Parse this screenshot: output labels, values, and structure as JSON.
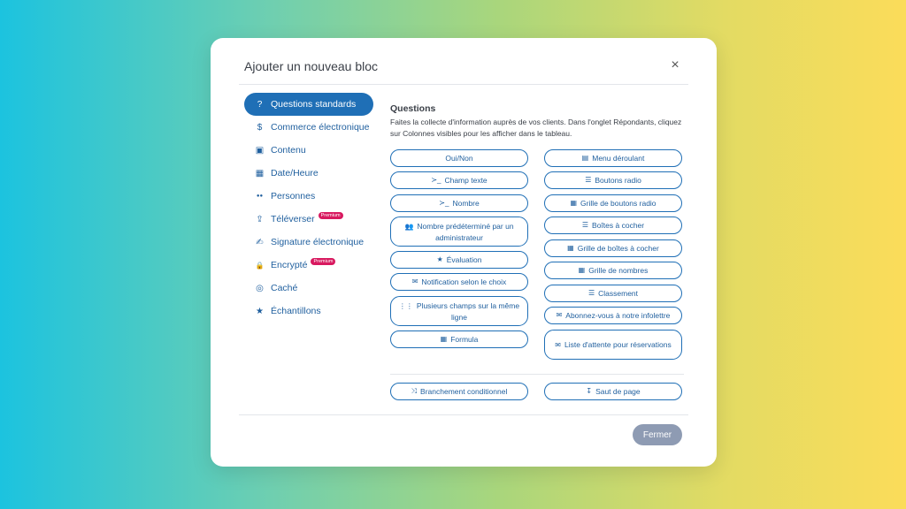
{
  "modal": {
    "title": "Ajouter un nouveau bloc",
    "close_symbol": "×",
    "footer_close": "Fermer"
  },
  "sidebar": {
    "items": [
      {
        "label": "Questions standards",
        "icon": "question-icon",
        "glyph": "?"
      },
      {
        "label": "Commerce électronique",
        "icon": "dollar-icon",
        "glyph": "$"
      },
      {
        "label": "Contenu",
        "icon": "image-icon",
        "glyph": "▣"
      },
      {
        "label": "Date/Heure",
        "icon": "calendar-icon",
        "glyph": "▦"
      },
      {
        "label": "Personnes",
        "icon": "users-icon",
        "glyph": "●●"
      },
      {
        "label": "Téléverser",
        "icon": "upload-icon",
        "glyph": "⇪",
        "badge": "Premium"
      },
      {
        "label": "Signature électronique",
        "icon": "signature-icon",
        "glyph": "✍"
      },
      {
        "label": "Encrypté",
        "icon": "lock-icon",
        "glyph": "🔒",
        "badge": "Premium"
      },
      {
        "label": "Caché",
        "icon": "eye-slash-icon",
        "glyph": "◎"
      },
      {
        "label": "Échantillons",
        "icon": "star-icon",
        "glyph": "★"
      }
    ]
  },
  "questions": {
    "title": "Questions",
    "description": "Faites la collecte d'information auprès de vos clients. Dans l'onglet Répondants, cliquez sur Colonnes visibles pour les afficher dans le tableau.",
    "left": [
      {
        "label": "Oui/Non",
        "glyph": ""
      },
      {
        "label": "Champ texte",
        "glyph": "≻_"
      },
      {
        "label": "Nombre",
        "glyph": "≻_"
      },
      {
        "label": "Nombre prédéterminé par un administrateur",
        "glyph": "👥"
      },
      {
        "label": "Évaluation",
        "glyph": "★"
      },
      {
        "label": "Notification selon le choix",
        "glyph": "✉"
      },
      {
        "label": "Plusieurs champs sur la même ligne",
        "glyph": "⋮⋮"
      },
      {
        "label": "Formula",
        "glyph": "▦"
      }
    ],
    "right": [
      {
        "label": "Menu déroulant",
        "glyph": "▤"
      },
      {
        "label": "Boutons radio",
        "glyph": "☰"
      },
      {
        "label": "Grille de boutons radio",
        "glyph": "▦"
      },
      {
        "label": "Boîtes à cocher",
        "glyph": "☰"
      },
      {
        "label": "Grille de boîtes à cocher",
        "glyph": "▦"
      },
      {
        "label": "Grille de nombres",
        "glyph": "▦"
      },
      {
        "label": "Classement",
        "glyph": "☰"
      },
      {
        "label": "Abonnez-vous à notre infolettre",
        "glyph": "✉"
      },
      {
        "label": "Liste d'attente pour réservations",
        "glyph": "✉"
      }
    ],
    "bottom": [
      {
        "label": "Branchement conditionnel",
        "glyph": "⤨"
      },
      {
        "label": "Saut de page",
        "glyph": "↧"
      }
    ]
  }
}
